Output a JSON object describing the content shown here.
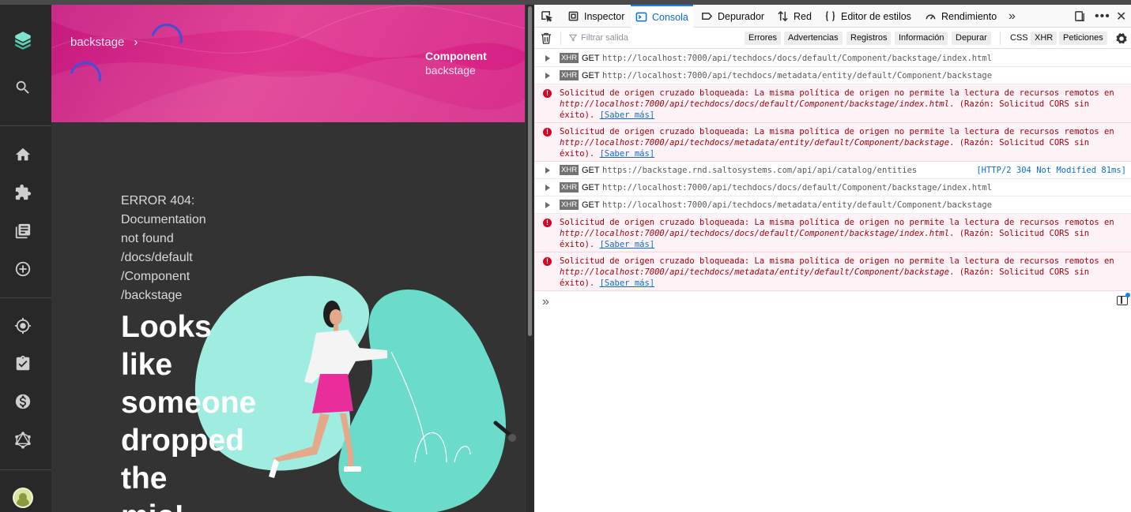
{
  "sidebar": {
    "icons": [
      "backstage-logo-icon",
      "search-icon",
      "home-icon",
      "puzzle-icon",
      "library-icon",
      "add-circle-icon",
      "radar-icon",
      "assignment-check-icon",
      "dollar-icon",
      "graphql-icon"
    ],
    "avatar": "avatar"
  },
  "header": {
    "breadcrumb": "backstage",
    "breadcrumb_sep": "›",
    "kind": "Component",
    "entity": "backstage",
    "color_from": "#c51a7f",
    "color_to": "#e0358e",
    "spinner_color": "#3f51d8"
  },
  "error_page": {
    "code_lines": [
      "ERROR 404:",
      "Documentation",
      "not found",
      "/docs/default",
      "/Component",
      "/backstage"
    ],
    "headline_lines": [
      "Looks",
      "like",
      "someone",
      "dropped",
      "the",
      "mic!"
    ]
  },
  "devtools": {
    "tabs": {
      "inspector": "Inspector",
      "console": "Consola",
      "debugger": "Depurador",
      "network": "Red",
      "style_editor": "Editor de estilos",
      "performance": "Rendimiento"
    },
    "filter_placeholder": "Filtrar salida",
    "filters": [
      "Errores",
      "Advertencias",
      "Registros",
      "Información",
      "Depurar",
      "CSS",
      "XHR",
      "Peticiones"
    ],
    "logs": [
      {
        "type": "xhr",
        "badge": "XHR",
        "method": "GET",
        "url": "http://localhost:7000/api/techdocs/docs/default/Component/backstage/index.html",
        "status": ""
      },
      {
        "type": "xhr",
        "badge": "XHR",
        "method": "GET",
        "url": "http://localhost:7000/api/techdocs/metadata/entity/default/Component/backstage",
        "status": ""
      },
      {
        "type": "error",
        "pre": "Solicitud de origen cruzado bloqueada: La misma política de origen no permite la lectura de recursos remotos en ",
        "url": "http://localhost:7000/api/techdocs/docs/default/Component/backstage/index.html",
        "post": ". (Razón: Solicitud CORS sin éxito).",
        "link": "[Saber más]"
      },
      {
        "type": "error",
        "pre": "Solicitud de origen cruzado bloqueada: La misma política de origen no permite la lectura de recursos remotos en ",
        "url": "http://localhost:7000/api/techdocs/metadata/entity/default/Component/backstage",
        "post": ". (Razón: Solicitud CORS sin éxito).",
        "link": "[Saber más]"
      },
      {
        "type": "xhr",
        "badge": "XHR",
        "method": "GET",
        "url": "https://backstage.rnd.saltosystems.com/api/api/catalog/entities",
        "status": "[HTTP/2 304 Not Modified 81ms]"
      },
      {
        "type": "xhr",
        "badge": "XHR",
        "method": "GET",
        "url": "http://localhost:7000/api/techdocs/docs/default/Component/backstage/index.html",
        "status": ""
      },
      {
        "type": "xhr",
        "badge": "XHR",
        "method": "GET",
        "url": "http://localhost:7000/api/techdocs/metadata/entity/default/Component/backstage",
        "status": ""
      },
      {
        "type": "error",
        "pre": "Solicitud de origen cruzado bloqueada: La misma política de origen no permite la lectura de recursos remotos en ",
        "url": "http://localhost:7000/api/techdocs/docs/default/Component/backstage/index.html",
        "post": ". (Razón: Solicitud CORS sin éxito).",
        "link": "[Saber más]"
      },
      {
        "type": "error",
        "pre": "Solicitud de origen cruzado bloqueada: La misma política de origen no permite la lectura de recursos remotos en ",
        "url": "http://localhost:7000/api/techdocs/metadata/entity/default/Component/backstage",
        "post": ". (Razón: Solicitud CORS sin éxito).",
        "link": "[Saber más]"
      }
    ],
    "prompt": "»"
  }
}
